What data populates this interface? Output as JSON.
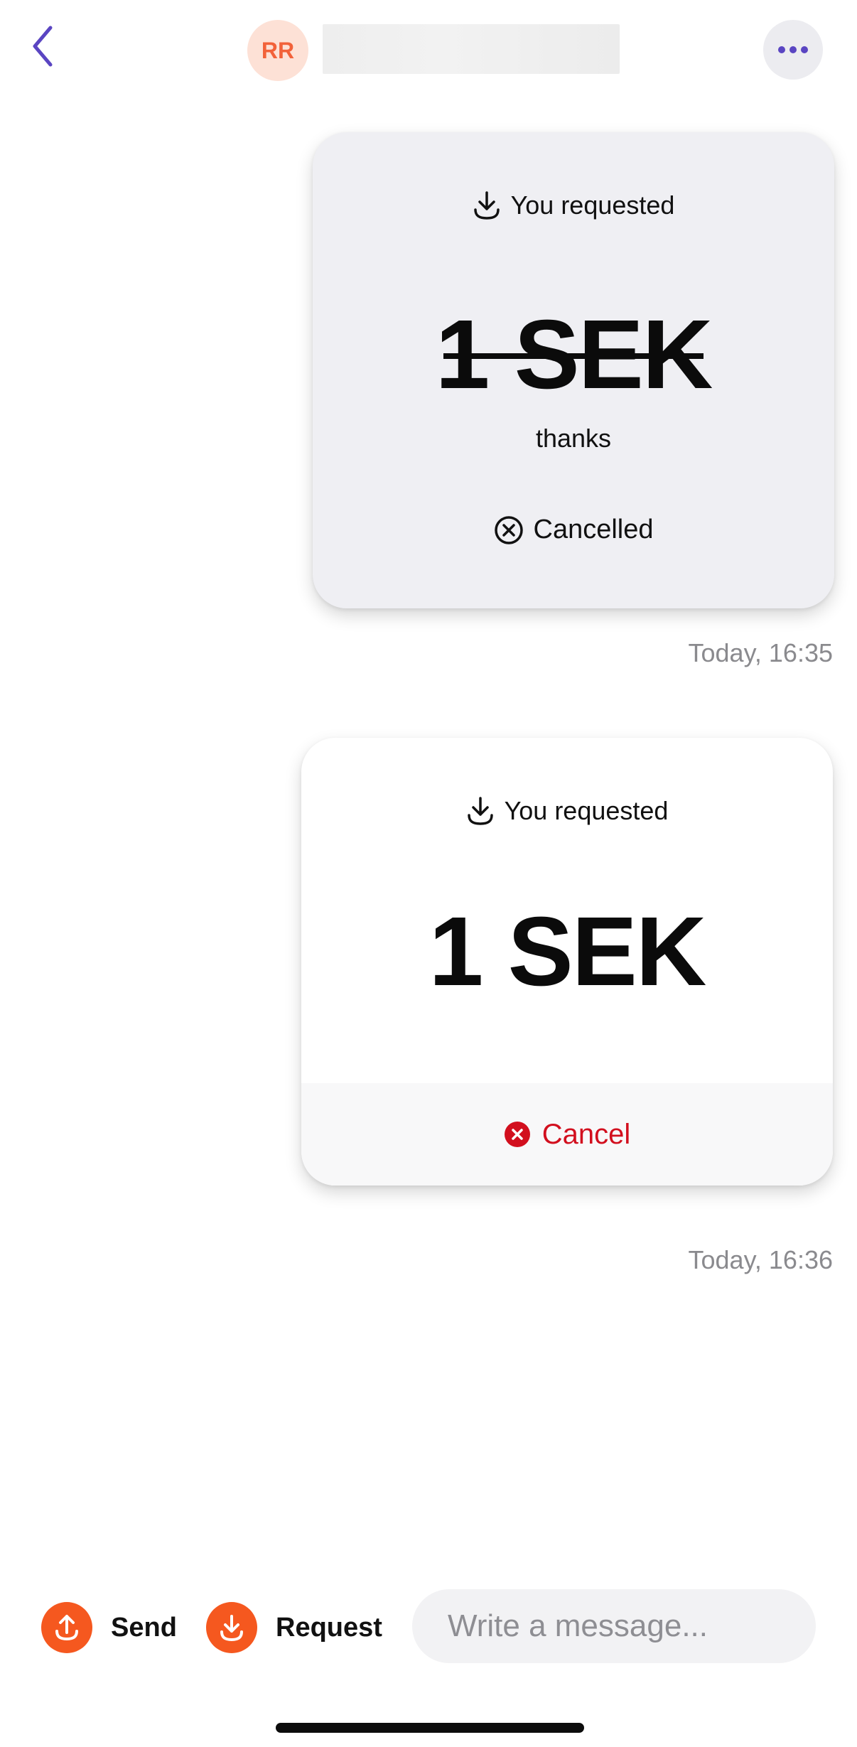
{
  "header": {
    "back_icon": "chevron-left-icon",
    "avatar_initials": "RR",
    "more_icon": "more-horizontal-icon",
    "accent_color": "#5a45c2"
  },
  "messages": [
    {
      "type_label": "You requested",
      "type_icon": "download-icon",
      "amount": "1 SEK",
      "note": "thanks",
      "status": "Cancelled",
      "status_icon": "x-circle-icon",
      "timestamp": "Today, 16:35"
    },
    {
      "type_label": "You requested",
      "type_icon": "download-icon",
      "amount": "1 SEK",
      "cancel_label": "Cancel",
      "cancel_icon": "x-circle-filled-icon",
      "timestamp": "Today, 16:36",
      "cancel_color": "#d20f1e"
    }
  ],
  "bottom_bar": {
    "send_label": "Send",
    "request_label": "Request",
    "message_placeholder": "Write a message...",
    "action_color": "#f5581f"
  }
}
